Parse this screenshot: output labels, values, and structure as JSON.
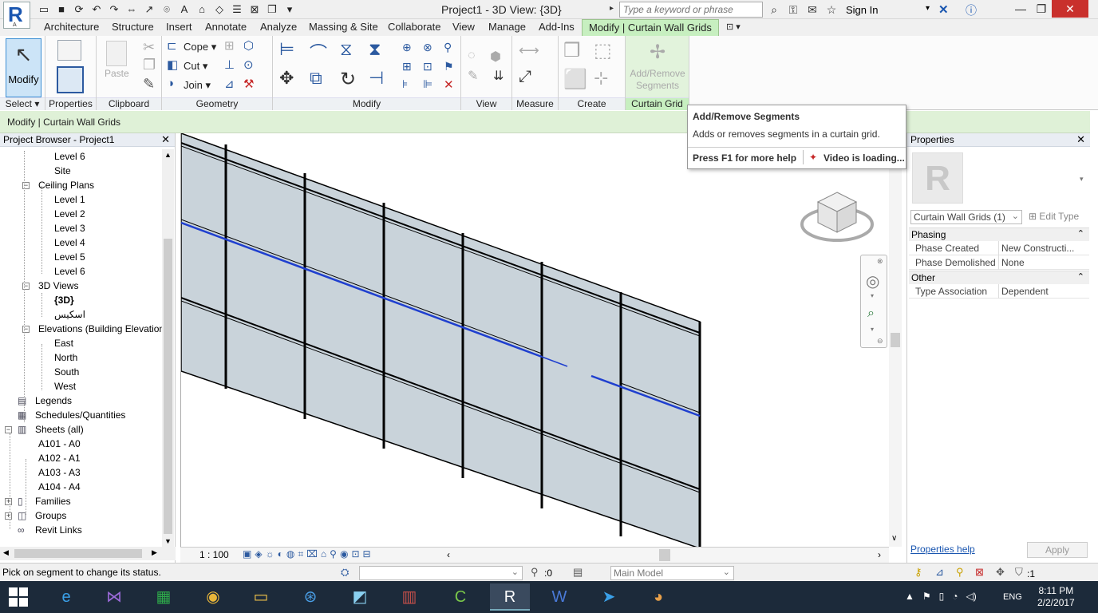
{
  "window": {
    "title": "Project1 - 3D View: {3D}",
    "app_letter": "R",
    "app_sub": "A",
    "search_placeholder": "Type a keyword or phrase",
    "sign_in": "Sign In"
  },
  "ribbon_tabs": [
    "Architecture",
    "Structure",
    "Insert",
    "Annotate",
    "Analyze",
    "Massing & Site",
    "Collaborate",
    "View",
    "Manage",
    "Add-Ins",
    "Modify | Curtain Wall Grids"
  ],
  "ribbon": {
    "modify_label": "Modify",
    "select_label": "Select",
    "properties_label": "Properties",
    "clipboard_label": "Clipboard",
    "paste_label": "Paste",
    "geometry_label": "Geometry",
    "cope_label": "Cope",
    "cut_label": "Cut",
    "join_label": "Join",
    "modify_panel_label": "Modify",
    "view_label": "View",
    "measure_label": "Measure",
    "create_label": "Create",
    "curtain_grid_label": "Curtain Grid",
    "add_remove_line1": "Add/Remove",
    "add_remove_line2": "Segments"
  },
  "context_bar": "Modify | Curtain Wall Grids",
  "tooltip": {
    "title": "Add/Remove Segments",
    "description": "Adds or removes segments in a curtain grid.",
    "help": "Press F1 for more help",
    "video": "Video is loading..."
  },
  "project_browser": {
    "title": "Project Browser - Project1",
    "items": [
      {
        "label": "Level 6"
      },
      {
        "label": "Site"
      },
      {
        "label": "Ceiling Plans"
      },
      {
        "label": "Level 1"
      },
      {
        "label": "Level 2"
      },
      {
        "label": "Level 3"
      },
      {
        "label": "Level 4"
      },
      {
        "label": "Level 5"
      },
      {
        "label": "Level 6"
      },
      {
        "label": "3D Views"
      },
      {
        "label": "{3D}"
      },
      {
        "label": "اسکیس"
      },
      {
        "label": "Elevations (Building Elevation"
      },
      {
        "label": "East"
      },
      {
        "label": "North"
      },
      {
        "label": "South"
      },
      {
        "label": "West"
      },
      {
        "label": "Legends"
      },
      {
        "label": "Schedules/Quantities"
      },
      {
        "label": "Sheets (all)"
      },
      {
        "label": "A101 - A0"
      },
      {
        "label": "A102 - A1"
      },
      {
        "label": "A103 - A3"
      },
      {
        "label": "A104 - A4"
      },
      {
        "label": "Families"
      },
      {
        "label": "Groups"
      },
      {
        "label": "Revit Links"
      }
    ]
  },
  "view_bar": {
    "scale": "1 : 100"
  },
  "properties": {
    "title": "Properties",
    "type_selector": "Curtain Wall Grids (1)",
    "edit_type": "Edit Type",
    "phasing_label": "Phasing",
    "phase_created_label": "Phase Created",
    "phase_created_value": "New Constructi...",
    "phase_demolished_label": "Phase Demolished",
    "phase_demolished_value": "None",
    "other_label": "Other",
    "type_association_label": "Type Association",
    "type_association_value": "Dependent",
    "help_link": "Properties help",
    "apply": "Apply"
  },
  "status": {
    "text": "Pick on segment to change its status.",
    "count": ":0",
    "workset": "Main Model",
    "filter_count": ":1"
  },
  "taskbar": {
    "lang": "ENG",
    "time": "8:11 PM",
    "date": "2/2/2017"
  },
  "colors": {
    "ribbon_context_green": "#c7efc0",
    "panel_fill": "#c9d3da",
    "selected_grid": "#1f3fcf",
    "taskbar": "#1c2a3a"
  }
}
